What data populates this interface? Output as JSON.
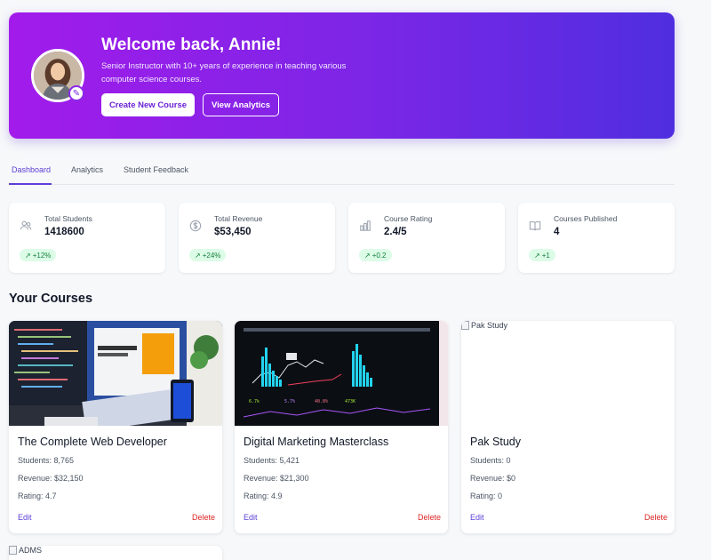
{
  "hero": {
    "title": "Welcome back, Annie!",
    "subtitle": "Senior Instructor with 10+ years of experience in teaching various computer science courses.",
    "primary_button": "Create New Course",
    "secondary_button": "View Analytics",
    "gradient_start": "#a21bea",
    "gradient_end": "#4f2ee0"
  },
  "tabs": [
    {
      "label": "Dashboard",
      "active": true
    },
    {
      "label": "Analytics",
      "active": false
    },
    {
      "label": "Student Feedback",
      "active": false
    }
  ],
  "stats": [
    {
      "label": "Total Students",
      "value": "1418600",
      "change": "+12%",
      "icon": "users-icon"
    },
    {
      "label": "Total Revenue",
      "value": "$53,450",
      "change": "+24%",
      "icon": "dollar-icon"
    },
    {
      "label": "Course Rating",
      "value": "2.4/5",
      "change": "+0.2",
      "icon": "bar-chart-icon"
    },
    {
      "label": "Courses Published",
      "value": "4",
      "change": "+1",
      "icon": "book-icon"
    }
  ],
  "section_title": "Your Courses",
  "courses": [
    {
      "title": "The Complete Web Developer",
      "students": "Students: 8,765",
      "revenue": "Revenue: $32,150",
      "rating": "Rating: 4.7",
      "edit": "Edit",
      "delete": "Delete"
    },
    {
      "title": "Digital Marketing Masterclass",
      "students": "Students: 5,421",
      "revenue": "Revenue: $21,300",
      "rating": "Rating: 4.9",
      "edit": "Edit",
      "delete": "Delete"
    },
    {
      "title": "Pak Study",
      "image_alt": "Pak Study",
      "students": "Students: 0",
      "revenue": "Revenue: $0",
      "rating": "Rating: 0",
      "edit": "Edit",
      "delete": "Delete"
    }
  ],
  "partial_course": {
    "image_alt": "ADMS"
  },
  "colors": {
    "accent": "#5b3fd6",
    "delete": "#dc2626",
    "badge_bg": "#dcfce7",
    "badge_text": "#15803d"
  }
}
